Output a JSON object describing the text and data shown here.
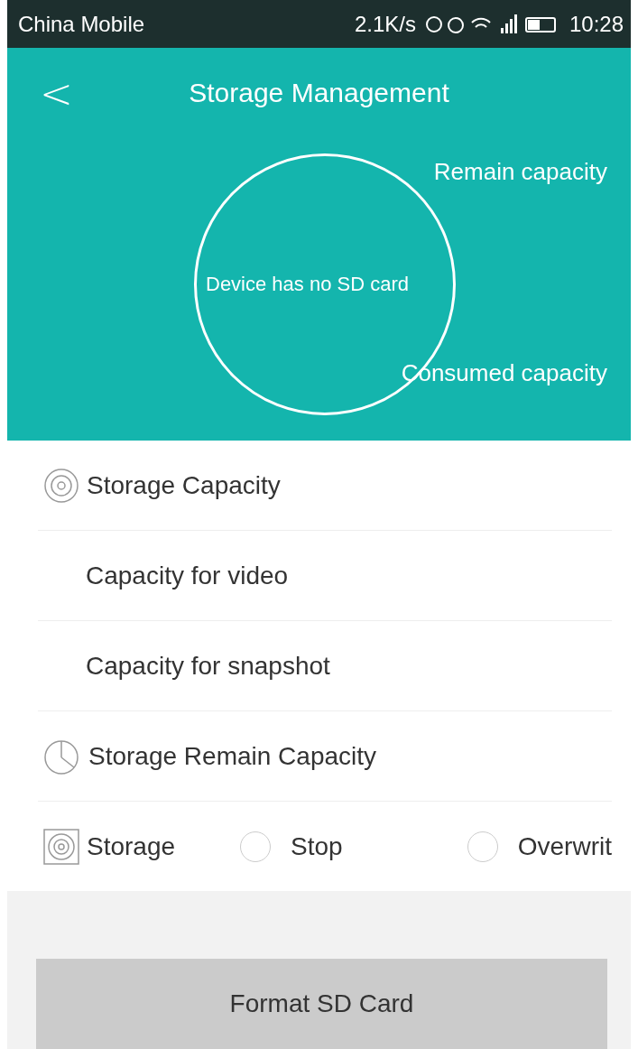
{
  "status_bar": {
    "carrier": "China Mobile",
    "speed": "2.1K/s",
    "time": "10:28"
  },
  "header": {
    "title": "Storage Management",
    "back": "<"
  },
  "chart": {
    "remain_label": "Remain capacity",
    "center_label": "Device has no SD card",
    "consumed_label": "Consumed capacity"
  },
  "rows": [
    {
      "kind": "capacity",
      "label": "Storage Capacity"
    },
    {
      "kind": "plain",
      "label": "Capacity for video"
    },
    {
      "kind": "plain",
      "label": "Capacity for snapshot"
    },
    {
      "kind": "remain",
      "label": "Storage Remain Capacity"
    },
    {
      "kind": "mode",
      "label": "Storage",
      "options": [
        {
          "label": "Stop",
          "selected": false
        },
        {
          "label": "Overwrit",
          "selected": false
        }
      ]
    }
  ],
  "format_button": "Format SD Card"
}
